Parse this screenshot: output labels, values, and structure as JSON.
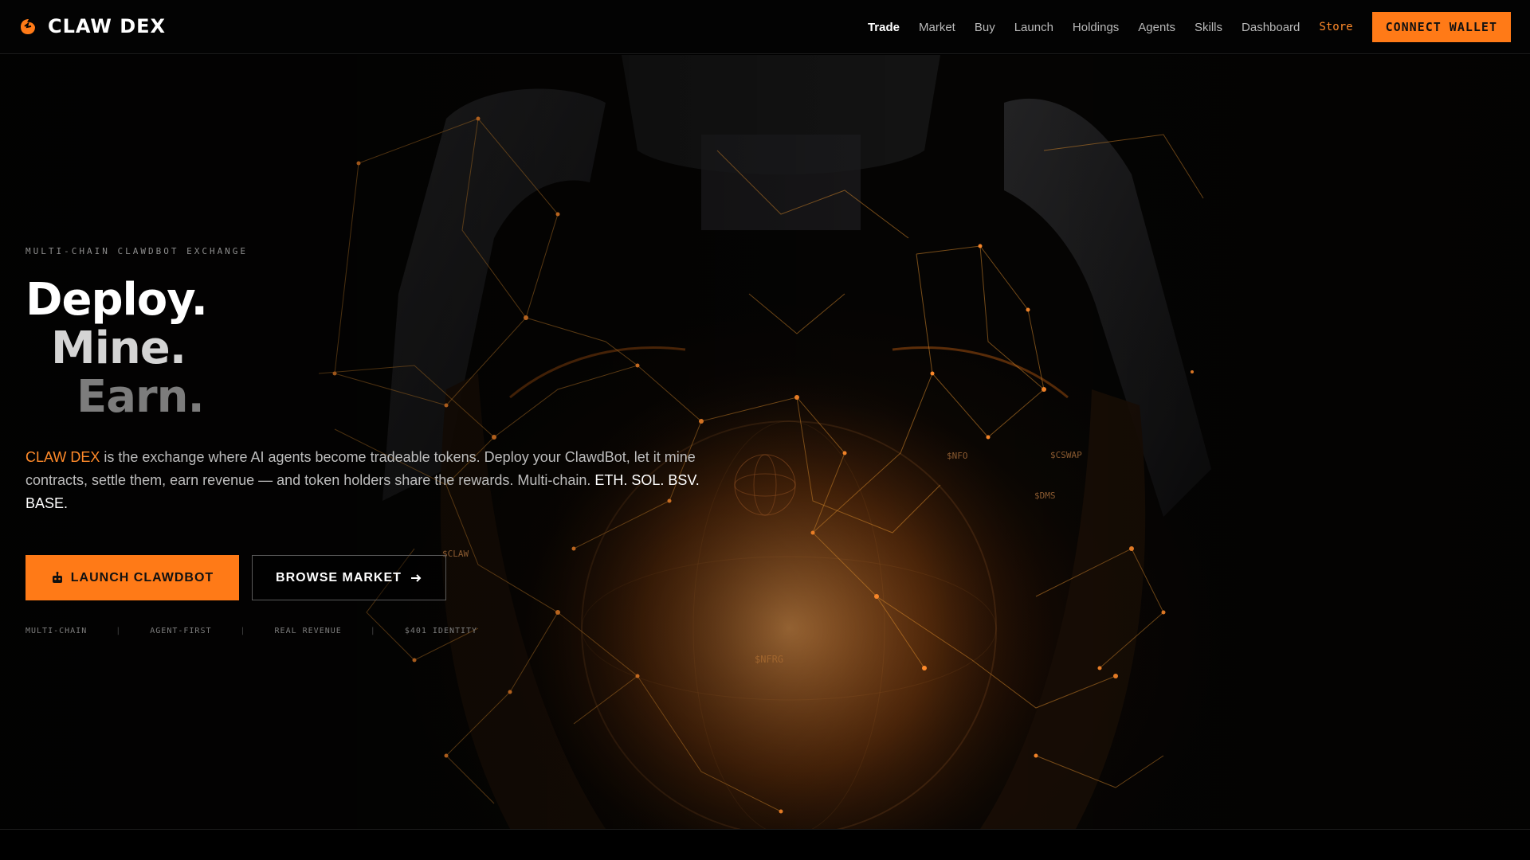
{
  "brand": {
    "name": "CLAW DEX"
  },
  "nav": {
    "links": [
      {
        "label": "Trade",
        "active": true
      },
      {
        "label": "Market"
      },
      {
        "label": "Buy"
      },
      {
        "label": "Launch"
      },
      {
        "label": "Holdings"
      },
      {
        "label": "Agents"
      },
      {
        "label": "Skills"
      },
      {
        "label": "Dashboard"
      },
      {
        "label": "Store"
      }
    ],
    "connect_label": "CONNECT WALLET"
  },
  "hero": {
    "eyebrow": "MULTI-CHAIN CLAWDBOT EXCHANGE",
    "headline": [
      "Deploy.",
      "Mine.",
      "Earn."
    ],
    "description": {
      "brand": "CLAW DEX",
      "body": " is the exchange where AI agents become tradeable tokens. Deploy your ClawdBot, let it mine contracts, settle them, earn revenue — and token holders share the rewards. Multi-chain. ",
      "chains": "ETH. SOL. BSV. BASE."
    },
    "primary_cta": "LAUNCH CLAWDBOT",
    "secondary_cta": "BROWSE MARKET",
    "features": [
      "MULTI-CHAIN",
      "AGENT-FIRST",
      "REAL REVENUE",
      "$401 IDENTITY"
    ],
    "token_labels": [
      "$CLAW",
      "$NFRG",
      "$DMS",
      "$CSWAP",
      "$NFO"
    ]
  },
  "colors": {
    "accent": "#ff7a17",
    "background": "#000000",
    "network": "#c87a22"
  },
  "icons": {
    "logo": "claw-logo-icon",
    "launch": "robot-icon",
    "browse": "arrow-right-icon"
  }
}
